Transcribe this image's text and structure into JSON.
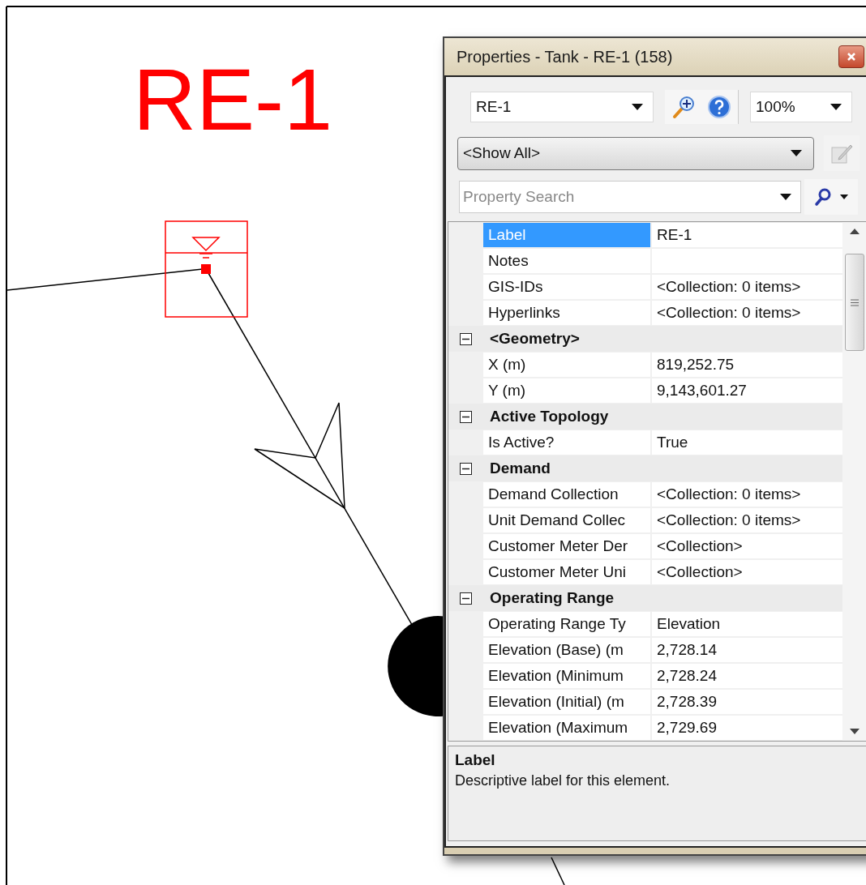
{
  "canvas": {
    "label": "RE-1"
  },
  "window": {
    "title": "Properties - Tank - RE-1 (158)"
  },
  "toolbar": {
    "element": "RE-1",
    "zoom": "100%",
    "filter": "<Show All>",
    "search_placeholder": "Property Search"
  },
  "grid": [
    {
      "kind": "property",
      "name": "Label",
      "value": "RE-1",
      "selected": true
    },
    {
      "kind": "property",
      "name": "Notes",
      "selected": false
    },
    {
      "kind": "property",
      "name": "GIS-IDs",
      "value": "<Collection: 0 items>",
      "selected": false
    },
    {
      "kind": "property",
      "name": "Hyperlinks",
      "value": "<Collection: 0 items>",
      "selected": false
    },
    {
      "kind": "category",
      "name": "<Geometry>",
      "expanded": true
    },
    {
      "kind": "property",
      "name": "X (m)",
      "value": "819,252.75",
      "selected": false
    },
    {
      "kind": "property",
      "name": "Y (m)",
      "value": "9,143,601.27",
      "selected": false
    },
    {
      "kind": "category",
      "name": "Active Topology",
      "expanded": true
    },
    {
      "kind": "property",
      "name": "Is Active?",
      "value": "True",
      "selected": false
    },
    {
      "kind": "category",
      "name": "Demand",
      "expanded": true
    },
    {
      "kind": "property",
      "name": "Demand Collection",
      "value": "<Collection: 0 items>",
      "selected": false
    },
    {
      "kind": "property",
      "name": "Unit Demand Collec",
      "value": "<Collection: 0 items>",
      "selected": false
    },
    {
      "kind": "property",
      "name": "Customer Meter Der",
      "value": "<Collection>",
      "selected": false
    },
    {
      "kind": "property",
      "name": "Customer Meter Uni",
      "value": "<Collection>",
      "selected": false
    },
    {
      "kind": "category",
      "name": "Operating Range",
      "expanded": true
    },
    {
      "kind": "property",
      "name": "Operating Range Ty",
      "value": "Elevation",
      "selected": false
    },
    {
      "kind": "property",
      "name": "Elevation (Base) (m",
      "value": "2,728.14",
      "selected": false
    },
    {
      "kind": "property",
      "name": "Elevation (Minimum",
      "value": "2,728.24",
      "selected": false
    },
    {
      "kind": "property",
      "name": "Elevation (Initial) (m",
      "value": "2,728.39",
      "selected": false
    },
    {
      "kind": "property",
      "name": "Elevation (Maximum",
      "value": "2,729.69",
      "selected": false
    }
  ],
  "description": {
    "title": "Label",
    "text": "Descriptive label for this element."
  }
}
